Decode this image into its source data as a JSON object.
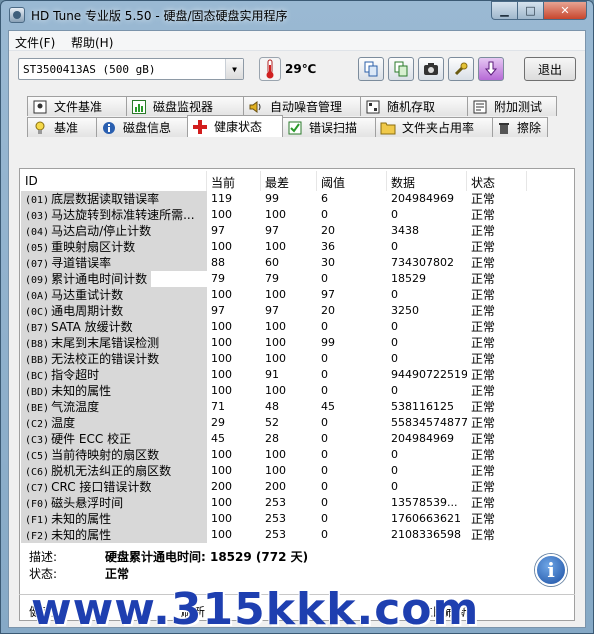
{
  "window": {
    "title": "HD Tune 专业版 5.50 - 硬盘/固态硬盘实用程序"
  },
  "menu": {
    "file": "文件(F)",
    "help": "帮助(H)"
  },
  "toolbar": {
    "drive": "ST3500413AS (500 gB)",
    "temperature": "29℃",
    "exit_label": "退出",
    "icons": [
      "copy-icon",
      "copy-green-icon",
      "camera-icon",
      "settings-wrench-icon",
      "download-arrow-icon"
    ]
  },
  "tabs_top": [
    {
      "label": "文件基准",
      "icon": "file-benchmark-icon"
    },
    {
      "label": "磁盘监视器",
      "icon": "disk-monitor-icon"
    },
    {
      "label": "自动噪音管理",
      "icon": "speaker-icon"
    },
    {
      "label": "随机存取",
      "icon": "random-access-icon"
    },
    {
      "label": "附加测试",
      "icon": "extra-tests-icon"
    }
  ],
  "tabs_bottom": [
    {
      "label": "基准",
      "icon": "bulb-icon"
    },
    {
      "label": "磁盘信息",
      "icon": "info-icon"
    },
    {
      "label": "健康状态",
      "icon": "red-cross-icon",
      "active": true
    },
    {
      "label": "错误扫描",
      "icon": "scan-icon"
    },
    {
      "label": "文件夹占用率",
      "icon": "folder-icon"
    },
    {
      "label": "擦除",
      "icon": "trash-icon"
    }
  ],
  "table": {
    "headers": {
      "id": "ID",
      "current": "当前",
      "worst": "最差",
      "threshold": "阈值",
      "data": "数据",
      "status": "状态"
    },
    "rows": [
      {
        "code": "(01)",
        "name": "底层数据读取错误率",
        "current": "119",
        "worst": "99",
        "threshold": "6",
        "data": "204984969",
        "status": "正常"
      },
      {
        "code": "(03)",
        "name": "马达旋转到标准转速所需...",
        "current": "100",
        "worst": "100",
        "threshold": "0",
        "data": "0",
        "status": "正常"
      },
      {
        "code": "(04)",
        "name": "马达启动/停止计数",
        "current": "97",
        "worst": "97",
        "threshold": "20",
        "data": "3438",
        "status": "正常"
      },
      {
        "code": "(05)",
        "name": "重映射扇区计数",
        "current": "100",
        "worst": "100",
        "threshold": "36",
        "data": "0",
        "status": "正常"
      },
      {
        "code": "(07)",
        "name": "寻道错误率",
        "current": "88",
        "worst": "60",
        "threshold": "30",
        "data": "734307802",
        "status": "正常"
      },
      {
        "code": "(09)",
        "name": "累计通电时间计数",
        "current": "79",
        "worst": "79",
        "threshold": "0",
        "data": "18529",
        "status": "正常"
      },
      {
        "code": "(0A)",
        "name": "马达重试计数",
        "current": "100",
        "worst": "100",
        "threshold": "97",
        "data": "0",
        "status": "正常"
      },
      {
        "code": "(0C)",
        "name": "通电周期计数",
        "current": "97",
        "worst": "97",
        "threshold": "20",
        "data": "3250",
        "status": "正常"
      },
      {
        "code": "(B7)",
        "name": "SATA 放缓计数",
        "current": "100",
        "worst": "100",
        "threshold": "0",
        "data": "0",
        "status": "正常"
      },
      {
        "code": "(B8)",
        "name": "末尾到末尾错误检测",
        "current": "100",
        "worst": "100",
        "threshold": "99",
        "data": "0",
        "status": "正常"
      },
      {
        "code": "(BB)",
        "name": "无法校正的错误计数",
        "current": "100",
        "worst": "100",
        "threshold": "0",
        "data": "0",
        "status": "正常"
      },
      {
        "code": "(BC)",
        "name": "指令超时",
        "current": "100",
        "worst": "91",
        "threshold": "0",
        "data": "94490722519",
        "status": "正常"
      },
      {
        "code": "(BD)",
        "name": "未知的属性",
        "current": "100",
        "worst": "100",
        "threshold": "0",
        "data": "0",
        "status": "正常"
      },
      {
        "code": "(BE)",
        "name": "气流温度",
        "current": "71",
        "worst": "48",
        "threshold": "45",
        "data": "538116125",
        "status": "正常"
      },
      {
        "code": "(C2)",
        "name": "温度",
        "current": "29",
        "worst": "52",
        "threshold": "0",
        "data": "55834574877",
        "status": "正常"
      },
      {
        "code": "(C3)",
        "name": "硬件 ECC 校正",
        "current": "45",
        "worst": "28",
        "threshold": "0",
        "data": "204984969",
        "status": "正常"
      },
      {
        "code": "(C5)",
        "name": "当前待映射的扇区数",
        "current": "100",
        "worst": "100",
        "threshold": "0",
        "data": "0",
        "status": "正常"
      },
      {
        "code": "(C6)",
        "name": "脱机无法纠正的扇区数",
        "current": "100",
        "worst": "100",
        "threshold": "0",
        "data": "0",
        "status": "正常"
      },
      {
        "code": "(C7)",
        "name": "CRC 接口错误计数",
        "current": "200",
        "worst": "200",
        "threshold": "0",
        "data": "0",
        "status": "正常"
      },
      {
        "code": "(F0)",
        "name": "磁头悬浮时间",
        "current": "100",
        "worst": "253",
        "threshold": "0",
        "data": "13578539...",
        "status": "正常"
      },
      {
        "code": "(F1)",
        "name": "未知的属性",
        "current": "100",
        "worst": "253",
        "threshold": "0",
        "data": "1760663621",
        "status": "正常"
      },
      {
        "code": "(F2)",
        "name": "未知的属性",
        "current": "100",
        "worst": "253",
        "threshold": "0",
        "data": "2108336598",
        "status": "正常"
      }
    ]
  },
  "details": {
    "desc_label": "描述:",
    "desc_value": "硬盘累计通电时间: 18529 (772 天)",
    "status_label": "状态:",
    "status_value": "正常"
  },
  "bottom": {
    "left": "健康",
    "mid": "刷新",
    "right": "立即刷新"
  },
  "watermark": "www.315kkk.com"
}
